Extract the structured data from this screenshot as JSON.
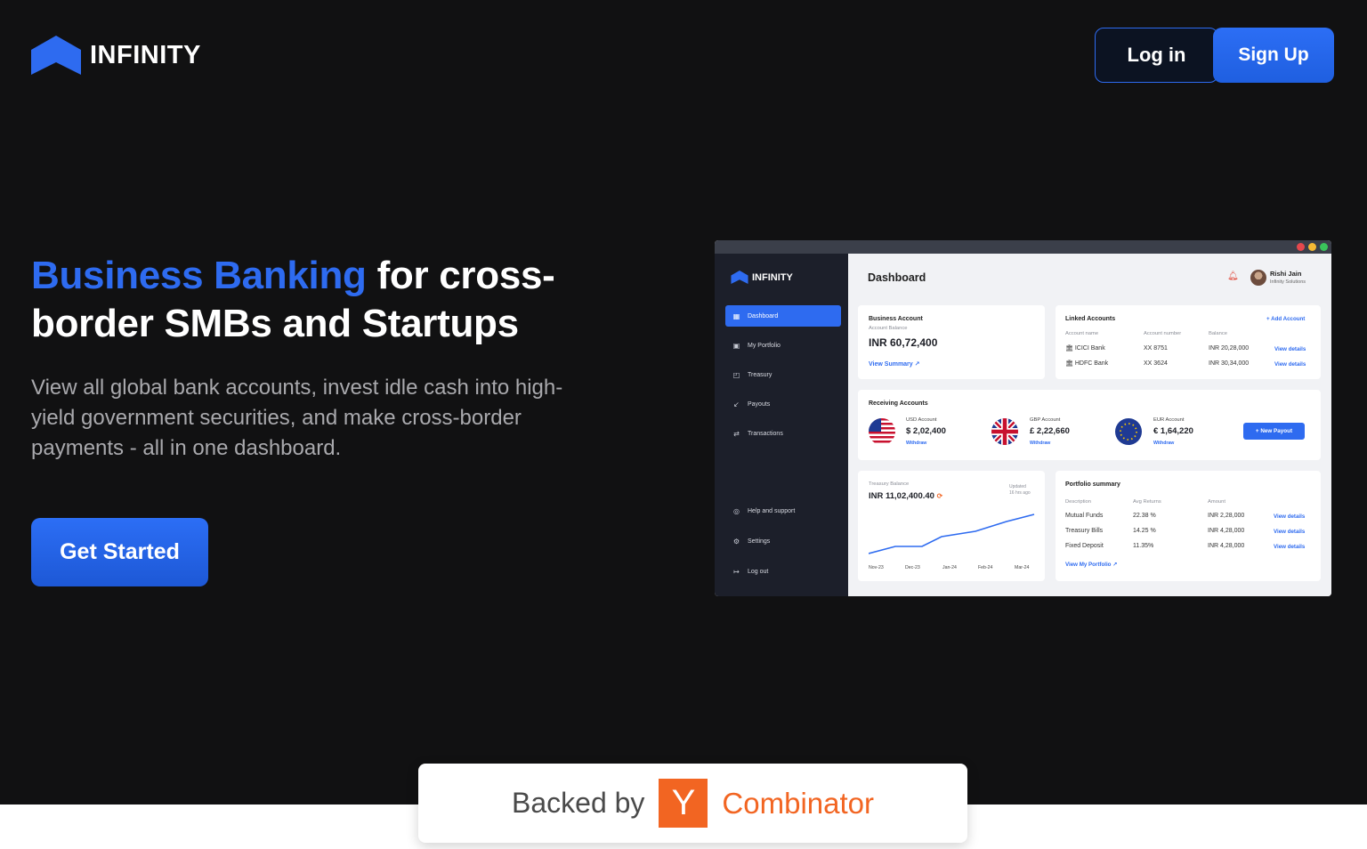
{
  "header": {
    "brand": "INFINITY",
    "login_label": "Log in",
    "signup_label": "Sign Up"
  },
  "hero": {
    "title_accent": "Business Banking",
    "title_rest": " for cross-border SMBs and Startups",
    "subtitle": "View all global bank accounts, invest idle cash into high-yield government securities, and make cross-border payments - all in one dashboard.",
    "cta_label": "Get Started"
  },
  "dashboard": {
    "brand": "INFINITY",
    "title": "Dashboard",
    "user": {
      "name": "Rishi Jain",
      "org": "Infinity Solutions"
    },
    "sidebar": {
      "items": [
        {
          "label": "Dashboard",
          "icon": "grid-icon",
          "active": true
        },
        {
          "label": "My Portfolio",
          "icon": "briefcase-icon"
        },
        {
          "label": "Treasury",
          "icon": "chart-icon"
        },
        {
          "label": "Payouts",
          "icon": "arrow-down-left-icon"
        },
        {
          "label": "Transactions",
          "icon": "swap-icon"
        }
      ],
      "bottom": [
        {
          "label": "Help and support",
          "icon": "lifebuoy-icon"
        },
        {
          "label": "Settings",
          "icon": "gear-icon"
        },
        {
          "label": "Log out",
          "icon": "logout-icon"
        }
      ]
    },
    "business_account": {
      "title": "Business Account",
      "balance_label": "Account Balance",
      "balance": "INR 60,72,400",
      "link": "View Summary"
    },
    "linked_accounts": {
      "title": "Linked Accounts",
      "add_label": "+ Add Account",
      "columns": [
        "Account name",
        "Account number",
        "Balance"
      ],
      "rows": [
        {
          "name": "ICICI Bank",
          "number": "XX 8751",
          "balance": "INR 20,28,000",
          "action": "View details"
        },
        {
          "name": "HDFC Bank",
          "number": "XX 3624",
          "balance": "INR 30,34,000",
          "action": "View details"
        }
      ]
    },
    "receiving": {
      "title": "Receiving Accounts",
      "accounts": [
        {
          "label": "USD Account",
          "amount": "$ 2,02,400",
          "action": "Withdraw"
        },
        {
          "label": "GBP Account",
          "amount": "£ 2,22,660",
          "action": "Withdraw"
        },
        {
          "label": "EUR Account",
          "amount": "€ 1,64,220",
          "action": "Withdraw"
        }
      ],
      "new_payout": "New Payout"
    },
    "treasury": {
      "label": "Treasury Balance",
      "balance": "INR 11,02,400.40",
      "updated": "Updated",
      "updated_ago": "16 hrs ago",
      "months": [
        "Nov-23",
        "Dec-23",
        "Jan-24",
        "Feb-24",
        "Mar-24"
      ]
    },
    "portfolio": {
      "title": "Portfolio summary",
      "columns": [
        "Description",
        "Avg Returns",
        "Amount"
      ],
      "rows": [
        {
          "desc": "Mutual Funds",
          "ret": "22.38 %",
          "amount": "INR 2,28,000",
          "action": "View details"
        },
        {
          "desc": "Treasury Bills",
          "ret": "14.25 %",
          "amount": "INR 4,28,000",
          "action": "View details"
        },
        {
          "desc": "Fixed Deposit",
          "ret": "11.35%",
          "amount": "INR 4,28,000",
          "action": "View details"
        }
      ],
      "link": "View My Portfolio"
    }
  },
  "backed": {
    "prefix": "Backed by",
    "y": "Y",
    "name": "Combinator"
  },
  "colors": {
    "accent": "#2e6bf0",
    "yc_orange": "#f26522",
    "background": "#111112"
  }
}
